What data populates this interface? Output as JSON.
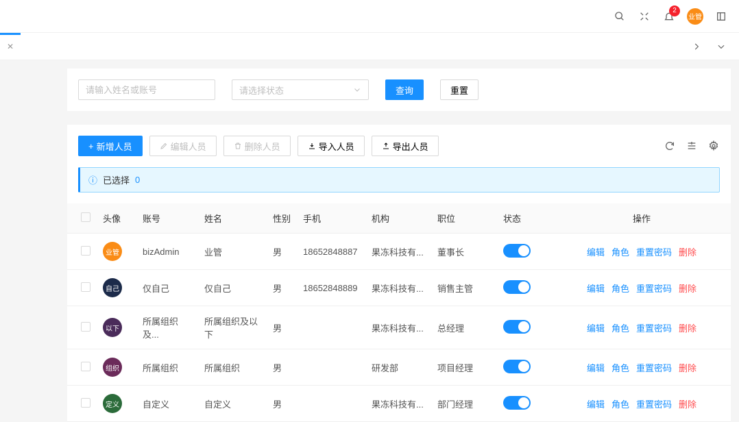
{
  "header": {
    "badge_count": "2",
    "avatar_text": "业管"
  },
  "filter": {
    "name_placeholder": "请输入姓名或账号",
    "status_placeholder": "请选择状态",
    "query": "查询",
    "reset": "重置"
  },
  "toolbar": {
    "add": "新增人员",
    "edit": "编辑人员",
    "delete": "删除人员",
    "import": "导入人员",
    "export": "导出人员"
  },
  "alert": {
    "label": "已选择",
    "count": "0"
  },
  "columns": {
    "avatar": "头像",
    "account": "账号",
    "name": "姓名",
    "gender": "性别",
    "phone": "手机",
    "org": "机构",
    "position": "职位",
    "status": "状态",
    "ops": "操作"
  },
  "ops": {
    "edit": "编辑",
    "role": "角色",
    "resetpw": "重置密码",
    "delete": "删除"
  },
  "rows": [
    {
      "avatar_text": "业管",
      "avatar_bg": "#fa8c16",
      "account": "bizAdmin",
      "name": "业管",
      "gender": "男",
      "phone": "18652848887",
      "org": "果冻科技有...",
      "position": "董事长"
    },
    {
      "avatar_text": "自己",
      "avatar_bg": "#1c2b4a",
      "account": "仅自己",
      "name": "仅自己",
      "gender": "男",
      "phone": "18652848889",
      "org": "果冻科技有...",
      "position": "销售主管"
    },
    {
      "avatar_text": "以下",
      "avatar_bg": "#4a2b5a",
      "account": "所属组织及...",
      "name": "所属组织及以下",
      "gender": "男",
      "phone": "",
      "org": "果冻科技有...",
      "position": "总经理"
    },
    {
      "avatar_text": "组织",
      "avatar_bg": "#6b2b5a",
      "account": "所属组织",
      "name": "所属组织",
      "gender": "男",
      "phone": "",
      "org": "研发部",
      "position": "项目经理"
    },
    {
      "avatar_text": "定义",
      "avatar_bg": "#2b6b3a",
      "account": "自定义",
      "name": "自定义",
      "gender": "男",
      "phone": "",
      "org": "果冻科技有...",
      "position": "部门经理"
    }
  ]
}
